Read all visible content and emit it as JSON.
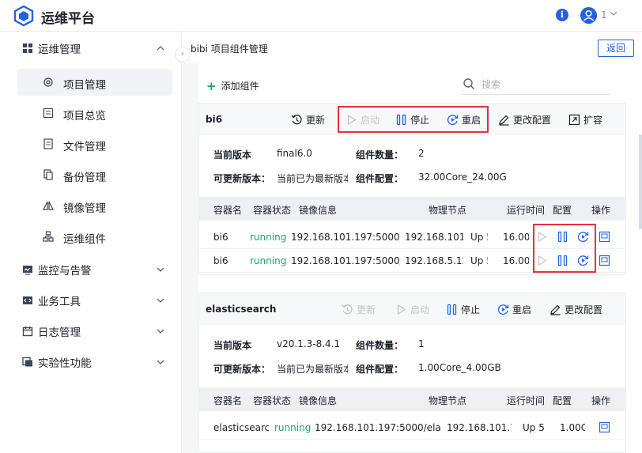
{
  "app": {
    "title": "运维平台",
    "user_name": "1",
    "info_icon": "i"
  },
  "sidebar": {
    "groups": [
      {
        "label": "运维管理",
        "icon": "grid-icon",
        "expanded": true
      },
      {
        "label": "监控与告警",
        "icon": "monitor-icon"
      },
      {
        "label": "业务工具",
        "icon": "code-icon"
      },
      {
        "label": "日志管理",
        "icon": "calendar-icon"
      },
      {
        "label": "实验性功能",
        "icon": "flask-icon"
      }
    ],
    "items": [
      {
        "label": "项目管理",
        "icon": "gear-icon",
        "active": true
      },
      {
        "label": "项目总览",
        "icon": "overview-icon"
      },
      {
        "label": "文件管理",
        "icon": "file-icon"
      },
      {
        "label": "备份管理",
        "icon": "backup-icon"
      },
      {
        "label": "镜像管理",
        "icon": "mirror-icon"
      },
      {
        "label": "运维组件",
        "icon": "component-icon"
      }
    ]
  },
  "header": {
    "page_title": "bibi 项目组件管理",
    "back_label": "返回"
  },
  "toolbar": {
    "add_label": "添加组件",
    "search_placeholder": "搜索"
  },
  "labels": {
    "current_version": "当前版本",
    "component_count": "组件数量：",
    "upgradable_version": "可更新版本：",
    "component_config": "组件配置：",
    "actions": {
      "update": "更新",
      "start": "启动",
      "stop": "停止",
      "restart": "重启",
      "modify_config": "更改配置",
      "scale": "扩容"
    },
    "columns": {
      "container": "容器名",
      "status": "容器状态",
      "image": "镜像信息",
      "node": "物理节点",
      "runtime": "运行时间",
      "config": "配置",
      "ops": "操作"
    }
  },
  "components": [
    {
      "name": "bi6",
      "current_version": "final6.0",
      "count": "2",
      "upgradable": "当前已为最新版本",
      "config": "32.00Core_24.00G",
      "rows": [
        {
          "container": "bi6",
          "status": "running",
          "image": "192.168.101.197:5000/bi6",
          "node": "192.168.101.79",
          "runtime": "Up 5 days",
          "config": "16.00Core_12.00G"
        },
        {
          "container": "bi6",
          "status": "running",
          "image": "192.168.101.197:5000/bi6",
          "node": "192.168.5.12",
          "runtime": "Up 5 days",
          "config": "16.00Core_12.00G"
        }
      ]
    },
    {
      "name": "elasticsearch",
      "current_version": "v20.1.3-8.4.1",
      "count": "1",
      "upgradable": "当前已为最新版本",
      "config": "1.00Core_4.00GB",
      "rows": [
        {
          "container": "elasticsearch",
          "status": "running",
          "image": "192.168.101.197:5000/elasticsearch",
          "node": "192.168.101.79",
          "runtime": "Up 5 days",
          "config": "1.00Core_4.00GB"
        }
      ]
    }
  ],
  "colors": {
    "primary": "#2461e6",
    "running": "#22a06b",
    "highlight": "#e5323b"
  }
}
